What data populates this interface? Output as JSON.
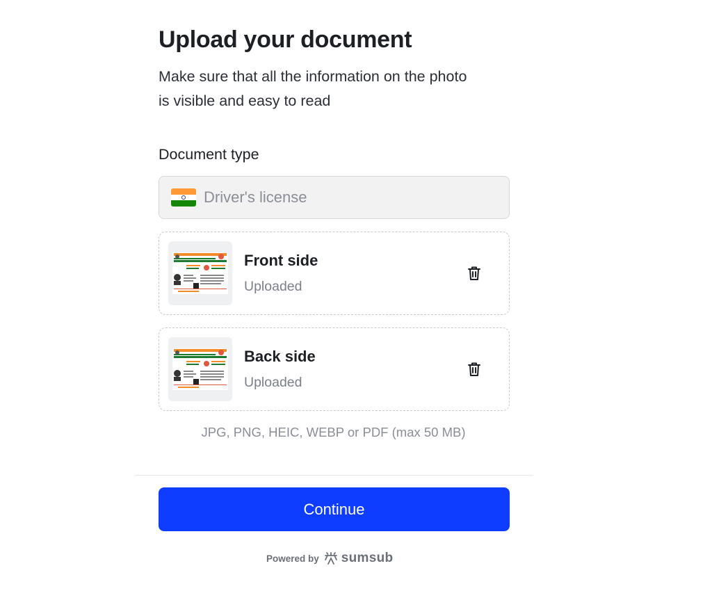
{
  "header": {
    "title": "Upload your document",
    "subtitle": "Make sure that all the information on the photo is visible and easy to read"
  },
  "document_type": {
    "label": "Document type",
    "selected_value": "Driver's license",
    "flag_icon": "india-flag-icon",
    "flag_colors": [
      "#ff9933",
      "#ffffff",
      "#138808"
    ]
  },
  "uploads": [
    {
      "title": "Front side",
      "status": "Uploaded",
      "delete_icon": "trash-icon"
    },
    {
      "title": "Back side",
      "status": "Uploaded",
      "delete_icon": "trash-icon"
    }
  ],
  "formats_note": "JPG, PNG, HEIC, WEBP or PDF (max 50 MB)",
  "actions": {
    "continue_label": "Continue"
  },
  "footer": {
    "powered_by": "Powered by",
    "brand": "sumsub"
  },
  "colors": {
    "primary": "#0f3dff",
    "text": "#1c1f24",
    "muted": "#8a8e96"
  }
}
